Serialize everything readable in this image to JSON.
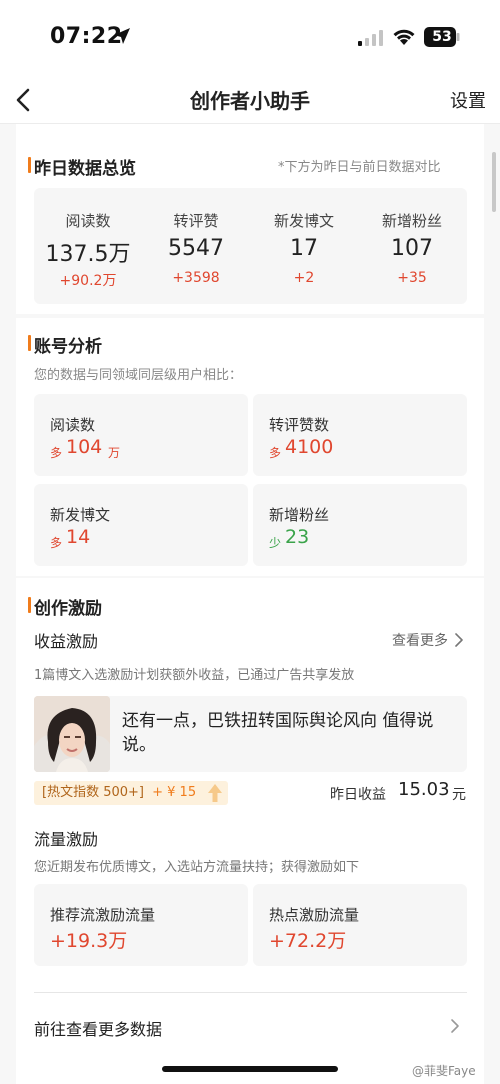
{
  "status_bar": {
    "time": "07:22",
    "battery": "53"
  },
  "nav": {
    "title": "创作者小助手",
    "settings_label": "设置"
  },
  "yesterday_overview": {
    "title": "昨日数据总览",
    "hint": "*下方为昨日与前日数据对比",
    "stats": [
      {
        "label": "阅读数",
        "value": "137.5万",
        "delta": "+90.2万"
      },
      {
        "label": "转评赞",
        "value": "5547",
        "delta": "+3598"
      },
      {
        "label": "新发博文",
        "value": "17",
        "delta": "+2"
      },
      {
        "label": "新增粉丝",
        "value": "107",
        "delta": "+35"
      }
    ]
  },
  "account_analysis": {
    "title": "账号分析",
    "subtitle": "您的数据与同领域同层级用户相比：",
    "metrics": [
      {
        "label": "阅读数",
        "prefix": "多",
        "value": "104",
        "unit": "万",
        "trend": "up"
      },
      {
        "label": "转评赞数",
        "prefix": "多",
        "value": "4100",
        "unit": "",
        "trend": "up"
      },
      {
        "label": "新发博文",
        "prefix": "多",
        "value": "14",
        "unit": "",
        "trend": "up"
      },
      {
        "label": "新增粉丝",
        "prefix": "少",
        "value": "23",
        "unit": "",
        "trend": "down"
      }
    ]
  },
  "creative_incentive": {
    "title": "创作激励",
    "revenue": {
      "heading": "收益激励",
      "view_more": "查看更多",
      "description": "1篇博文入选激励计划获额外收益，已通过广告共享发放",
      "post_text": "还有一点，巴铁扭转国际舆论风向 值得说说。",
      "hot_badge": "[热文指数 500+]",
      "hot_reward": "+ ¥ 15",
      "yesterday_label": "昨日收益",
      "yesterday_value": "15.03",
      "yesterday_unit": "元"
    },
    "traffic": {
      "heading": "流量激励",
      "description": "您近期发布优质博文，入选站方流量扶持；获得激励如下",
      "items": [
        {
          "label": "推荐流激励流量",
          "value": "+19.3万"
        },
        {
          "label": "热点激励流量",
          "value": "+72.2万"
        }
      ]
    },
    "more_data_link": "前往查看更多数据"
  },
  "watermark": "@菲斐Faye",
  "colors": {
    "accent": "#f07c1c",
    "up": "#e0472f",
    "down": "#3aa34a"
  },
  "icons": [
    "location-arrow-icon",
    "signal-icon",
    "wifi-icon",
    "battery-icon",
    "back-icon",
    "chevron-right-icon"
  ]
}
